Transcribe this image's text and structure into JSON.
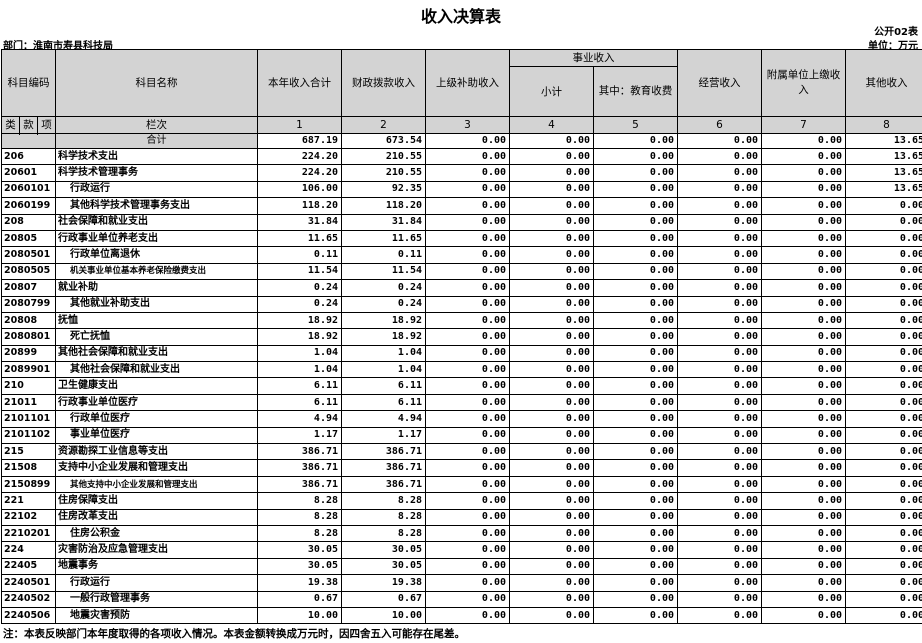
{
  "title": "收入决算表",
  "form_code": "公开02表",
  "department": "部门：淮南市寿县科技局",
  "unit": "单位：万元",
  "headers": {
    "subject_code": "科目编码",
    "subject_name": "科目名称",
    "total_income": "本年收入合计",
    "fiscal": "财政拨款收入",
    "superior": "上级补助收入",
    "business_group": "事业收入",
    "business_subtotal": "小计",
    "business_edu": "其中：教育收费",
    "operating": "经营收入",
    "affiliated": "附属单位上缴收入",
    "other": "其他收入",
    "lei": "类",
    "kuan": "款",
    "xiang": "项",
    "column_order": "栏次",
    "col_nums": [
      "1",
      "2",
      "3",
      "4",
      "5",
      "6",
      "7",
      "8"
    ]
  },
  "total_row": {
    "label": "合计",
    "values": [
      "687.19",
      "673.54",
      "0.00",
      "0.00",
      "0.00",
      "0.00",
      "0.00",
      "13.65"
    ]
  },
  "rows": [
    {
      "code": "206",
      "name": "科学技术支出",
      "indent": false,
      "small": false,
      "values": [
        "224.20",
        "210.55",
        "0.00",
        "0.00",
        "0.00",
        "0.00",
        "0.00",
        "13.65"
      ]
    },
    {
      "code": "20601",
      "name": "科学技术管理事务",
      "indent": false,
      "small": false,
      "values": [
        "224.20",
        "210.55",
        "0.00",
        "0.00",
        "0.00",
        "0.00",
        "0.00",
        "13.65"
      ]
    },
    {
      "code": "2060101",
      "name": "行政运行",
      "indent": true,
      "small": false,
      "values": [
        "106.00",
        "92.35",
        "0.00",
        "0.00",
        "0.00",
        "0.00",
        "0.00",
        "13.65"
      ]
    },
    {
      "code": "2060199",
      "name": "其他科学技术管理事务支出",
      "indent": true,
      "small": false,
      "values": [
        "118.20",
        "118.20",
        "0.00",
        "0.00",
        "0.00",
        "0.00",
        "0.00",
        "0.00"
      ]
    },
    {
      "code": "208",
      "name": "社会保障和就业支出",
      "indent": false,
      "small": false,
      "values": [
        "31.84",
        "31.84",
        "0.00",
        "0.00",
        "0.00",
        "0.00",
        "0.00",
        "0.00"
      ]
    },
    {
      "code": "20805",
      "name": "行政事业单位养老支出",
      "indent": false,
      "small": false,
      "values": [
        "11.65",
        "11.65",
        "0.00",
        "0.00",
        "0.00",
        "0.00",
        "0.00",
        "0.00"
      ]
    },
    {
      "code": "2080501",
      "name": "行政单位离退休",
      "indent": true,
      "small": false,
      "values": [
        "0.11",
        "0.11",
        "0.00",
        "0.00",
        "0.00",
        "0.00",
        "0.00",
        "0.00"
      ]
    },
    {
      "code": "2080505",
      "name": "机关事业单位基本养老保险缴费支出",
      "indent": true,
      "small": true,
      "values": [
        "11.54",
        "11.54",
        "0.00",
        "0.00",
        "0.00",
        "0.00",
        "0.00",
        "0.00"
      ]
    },
    {
      "code": "20807",
      "name": "就业补助",
      "indent": false,
      "small": false,
      "values": [
        "0.24",
        "0.24",
        "0.00",
        "0.00",
        "0.00",
        "0.00",
        "0.00",
        "0.00"
      ]
    },
    {
      "code": "2080799",
      "name": "其他就业补助支出",
      "indent": true,
      "small": false,
      "values": [
        "0.24",
        "0.24",
        "0.00",
        "0.00",
        "0.00",
        "0.00",
        "0.00",
        "0.00"
      ]
    },
    {
      "code": "20808",
      "name": "抚恤",
      "indent": false,
      "small": false,
      "values": [
        "18.92",
        "18.92",
        "0.00",
        "0.00",
        "0.00",
        "0.00",
        "0.00",
        "0.00"
      ]
    },
    {
      "code": "2080801",
      "name": "死亡抚恤",
      "indent": true,
      "small": false,
      "values": [
        "18.92",
        "18.92",
        "0.00",
        "0.00",
        "0.00",
        "0.00",
        "0.00",
        "0.00"
      ]
    },
    {
      "code": "20899",
      "name": "其他社会保障和就业支出",
      "indent": false,
      "small": false,
      "values": [
        "1.04",
        "1.04",
        "0.00",
        "0.00",
        "0.00",
        "0.00",
        "0.00",
        "0.00"
      ]
    },
    {
      "code": "2089901",
      "name": "其他社会保障和就业支出",
      "indent": true,
      "small": false,
      "values": [
        "1.04",
        "1.04",
        "0.00",
        "0.00",
        "0.00",
        "0.00",
        "0.00",
        "0.00"
      ]
    },
    {
      "code": "210",
      "name": "卫生健康支出",
      "indent": false,
      "small": false,
      "values": [
        "6.11",
        "6.11",
        "0.00",
        "0.00",
        "0.00",
        "0.00",
        "0.00",
        "0.00"
      ]
    },
    {
      "code": "21011",
      "name": "行政事业单位医疗",
      "indent": false,
      "small": false,
      "values": [
        "6.11",
        "6.11",
        "0.00",
        "0.00",
        "0.00",
        "0.00",
        "0.00",
        "0.00"
      ]
    },
    {
      "code": "2101101",
      "name": "行政单位医疗",
      "indent": true,
      "small": false,
      "values": [
        "4.94",
        "4.94",
        "0.00",
        "0.00",
        "0.00",
        "0.00",
        "0.00",
        "0.00"
      ]
    },
    {
      "code": "2101102",
      "name": "事业单位医疗",
      "indent": true,
      "small": false,
      "values": [
        "1.17",
        "1.17",
        "0.00",
        "0.00",
        "0.00",
        "0.00",
        "0.00",
        "0.00"
      ]
    },
    {
      "code": "215",
      "name": "资源勘探工业信息等支出",
      "indent": false,
      "small": false,
      "values": [
        "386.71",
        "386.71",
        "0.00",
        "0.00",
        "0.00",
        "0.00",
        "0.00",
        "0.00"
      ]
    },
    {
      "code": "21508",
      "name": "支持中小企业发展和管理支出",
      "indent": false,
      "small": false,
      "values": [
        "386.71",
        "386.71",
        "0.00",
        "0.00",
        "0.00",
        "0.00",
        "0.00",
        "0.00"
      ]
    },
    {
      "code": "2150899",
      "name": "其他支持中小企业发展和管理支出",
      "indent": true,
      "small": true,
      "values": [
        "386.71",
        "386.71",
        "0.00",
        "0.00",
        "0.00",
        "0.00",
        "0.00",
        "0.00"
      ]
    },
    {
      "code": "221",
      "name": "住房保障支出",
      "indent": false,
      "small": false,
      "values": [
        "8.28",
        "8.28",
        "0.00",
        "0.00",
        "0.00",
        "0.00",
        "0.00",
        "0.00"
      ]
    },
    {
      "code": "22102",
      "name": "住房改革支出",
      "indent": false,
      "small": false,
      "values": [
        "8.28",
        "8.28",
        "0.00",
        "0.00",
        "0.00",
        "0.00",
        "0.00",
        "0.00"
      ]
    },
    {
      "code": "2210201",
      "name": "住房公积金",
      "indent": true,
      "small": false,
      "values": [
        "8.28",
        "8.28",
        "0.00",
        "0.00",
        "0.00",
        "0.00",
        "0.00",
        "0.00"
      ]
    },
    {
      "code": "224",
      "name": "灾害防治及应急管理支出",
      "indent": false,
      "small": false,
      "values": [
        "30.05",
        "30.05",
        "0.00",
        "0.00",
        "0.00",
        "0.00",
        "0.00",
        "0.00"
      ]
    },
    {
      "code": "22405",
      "name": "地震事务",
      "indent": false,
      "small": false,
      "values": [
        "30.05",
        "30.05",
        "0.00",
        "0.00",
        "0.00",
        "0.00",
        "0.00",
        "0.00"
      ]
    },
    {
      "code": "2240501",
      "name": "行政运行",
      "indent": true,
      "small": false,
      "values": [
        "19.38",
        "19.38",
        "0.00",
        "0.00",
        "0.00",
        "0.00",
        "0.00",
        "0.00"
      ]
    },
    {
      "code": "2240502",
      "name": "一般行政管理事务",
      "indent": true,
      "small": false,
      "values": [
        "0.67",
        "0.67",
        "0.00",
        "0.00",
        "0.00",
        "0.00",
        "0.00",
        "0.00"
      ]
    },
    {
      "code": "2240506",
      "name": "地震灾害预防",
      "indent": true,
      "small": false,
      "values": [
        "10.00",
        "10.00",
        "0.00",
        "0.00",
        "0.00",
        "0.00",
        "0.00",
        "0.00"
      ]
    }
  ],
  "footnote": "注：本表反映部门本年度取得的各项收入情况。本表金额转换成万元时，因四舍五入可能存在尾差。"
}
